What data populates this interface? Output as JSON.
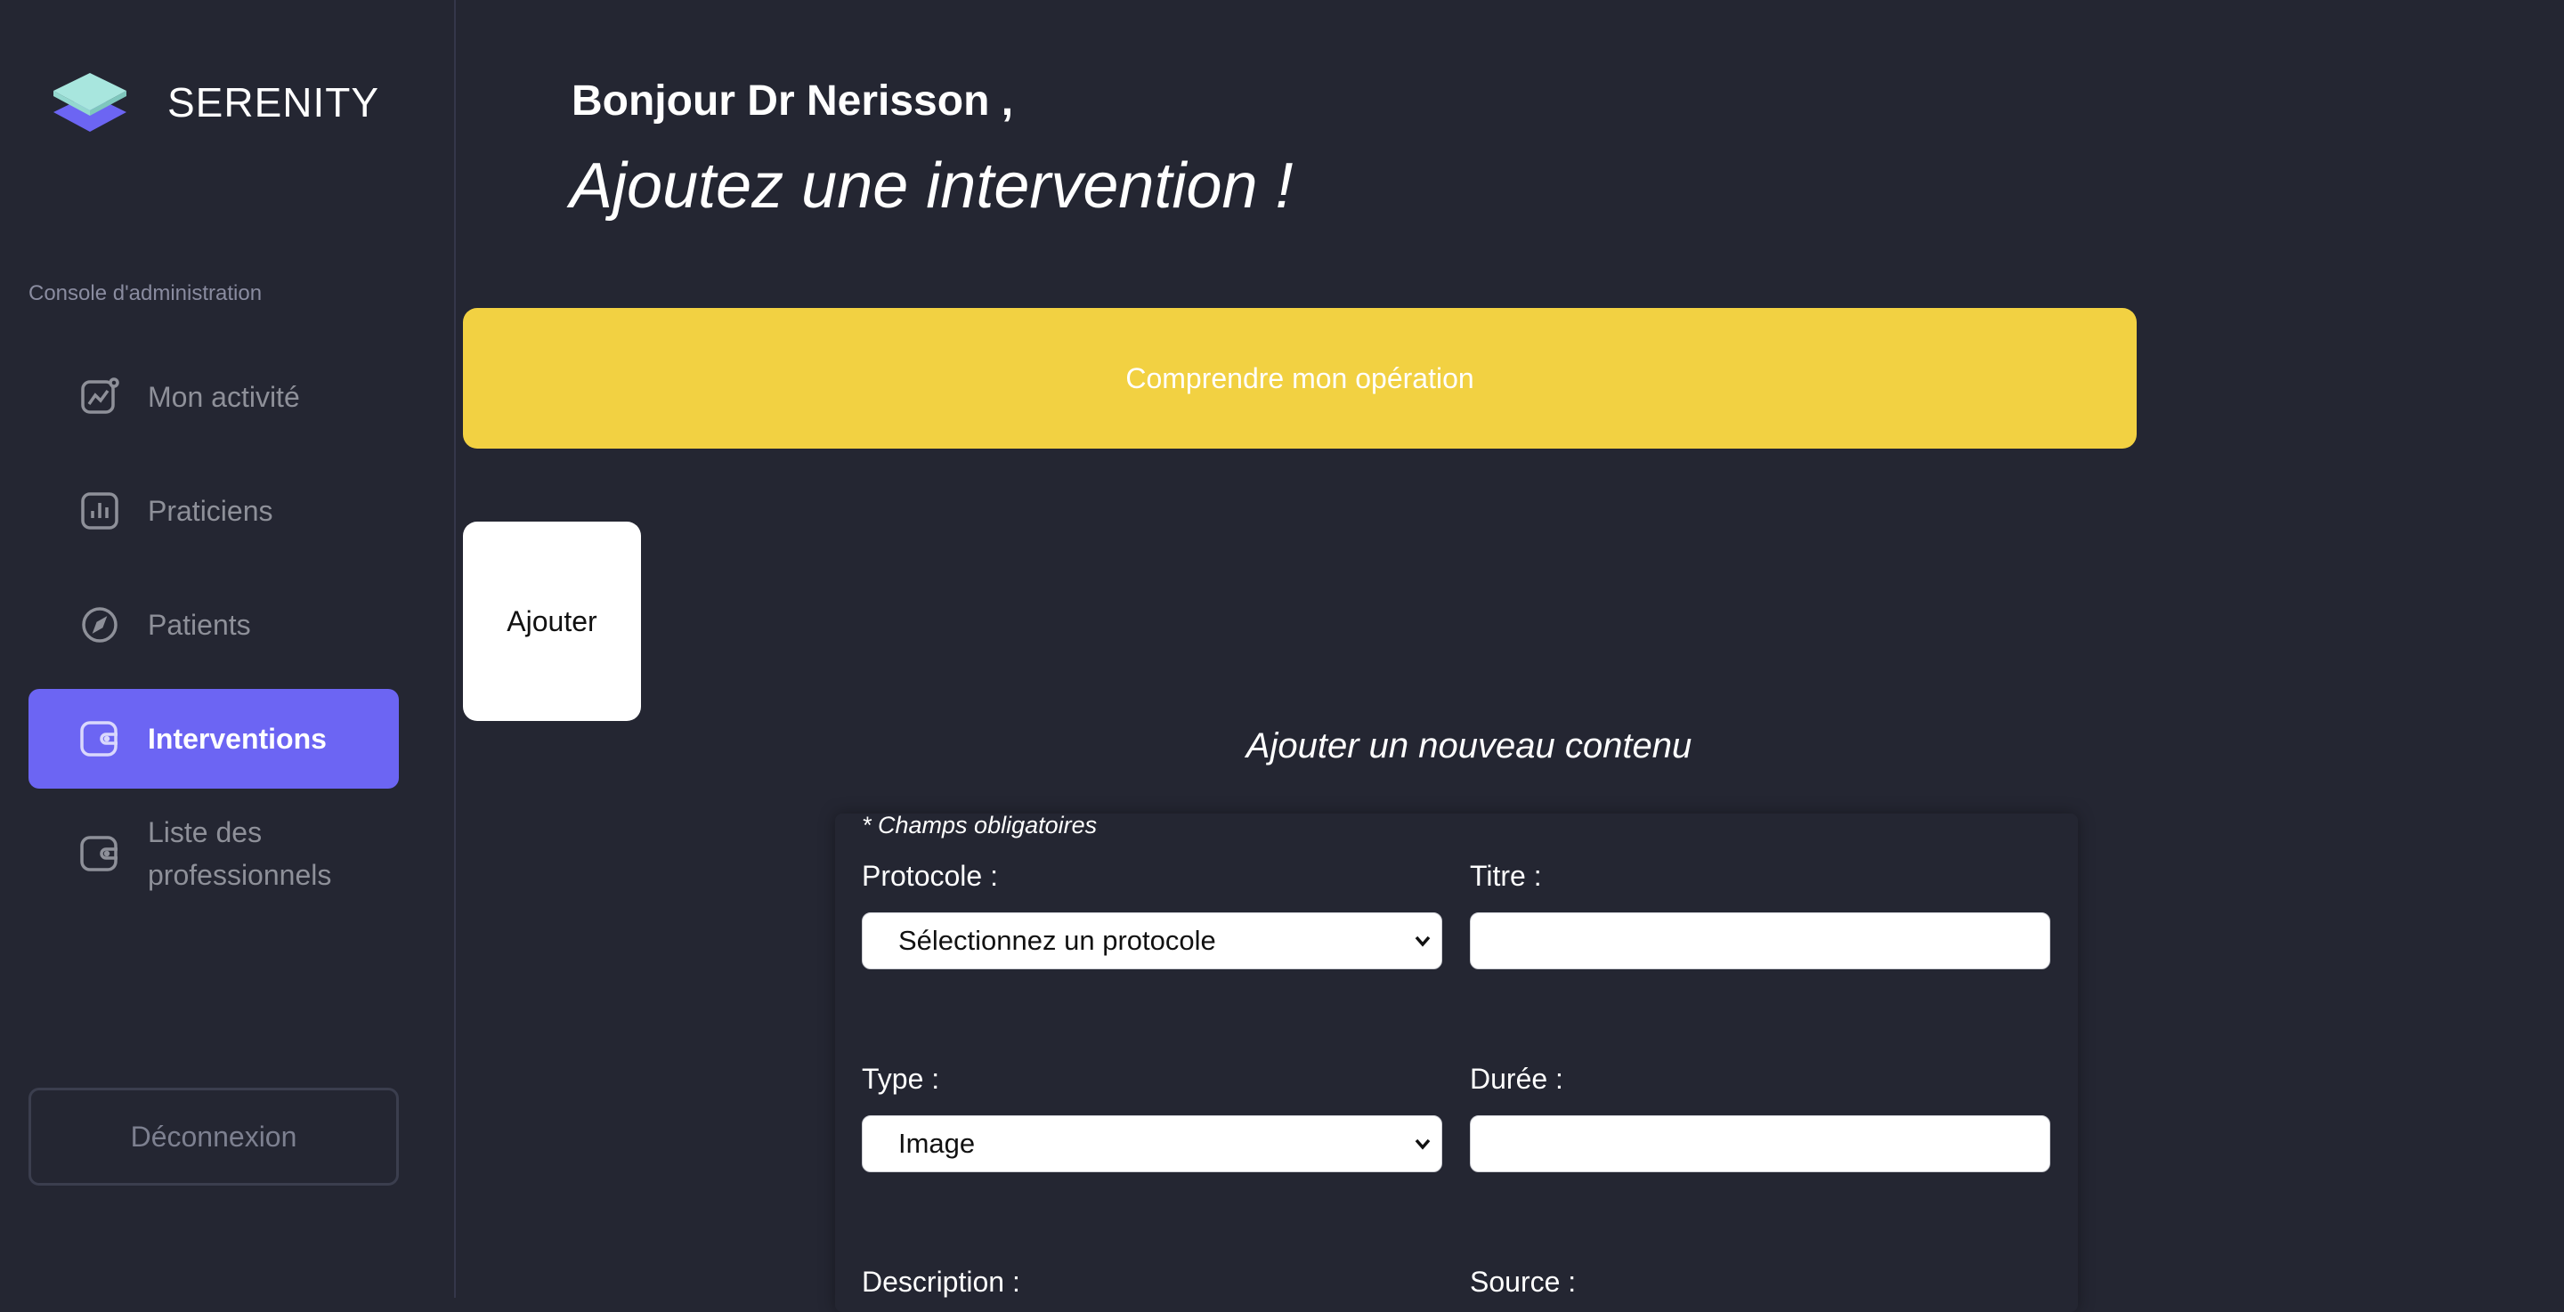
{
  "brand": {
    "name": "SERENITY"
  },
  "sidebar": {
    "section_label": "Console d'administration",
    "items": [
      {
        "label": "Mon activité",
        "icon": "activity-chart-icon"
      },
      {
        "label": "Praticiens",
        "icon": "bar-chart-icon"
      },
      {
        "label": "Patients",
        "icon": "compass-icon"
      },
      {
        "label": "Interventions",
        "icon": "wallet-icon",
        "active": true
      },
      {
        "label": "Liste des professionnels",
        "icon": "wallet-icon"
      }
    ],
    "logout_label": "Déconnexion"
  },
  "header": {
    "greeting": "Bonjour Dr Nerisson ,",
    "headline": "Ajoutez une intervention !"
  },
  "banner": {
    "label": "Comprendre mon opération"
  },
  "add_card": {
    "label": "Ajouter"
  },
  "form": {
    "section_title": "Ajouter un nouveau contenu",
    "required_note": "* Champs obligatoires",
    "protocole": {
      "label": "Protocole :",
      "value": "Sélectionnez un protocole"
    },
    "titre": {
      "label": "Titre :",
      "value": ""
    },
    "type": {
      "label": "Type :",
      "value": "Image"
    },
    "duree": {
      "label": "Durée :",
      "value": ""
    },
    "description": {
      "label": "Description :"
    },
    "source": {
      "label": "Source :"
    }
  },
  "colors": {
    "background": "#242632",
    "accent": "#6c65f3",
    "banner": "#f2d142",
    "logo_top": "#a8e6de",
    "logo_bottom": "#6c65f3"
  }
}
